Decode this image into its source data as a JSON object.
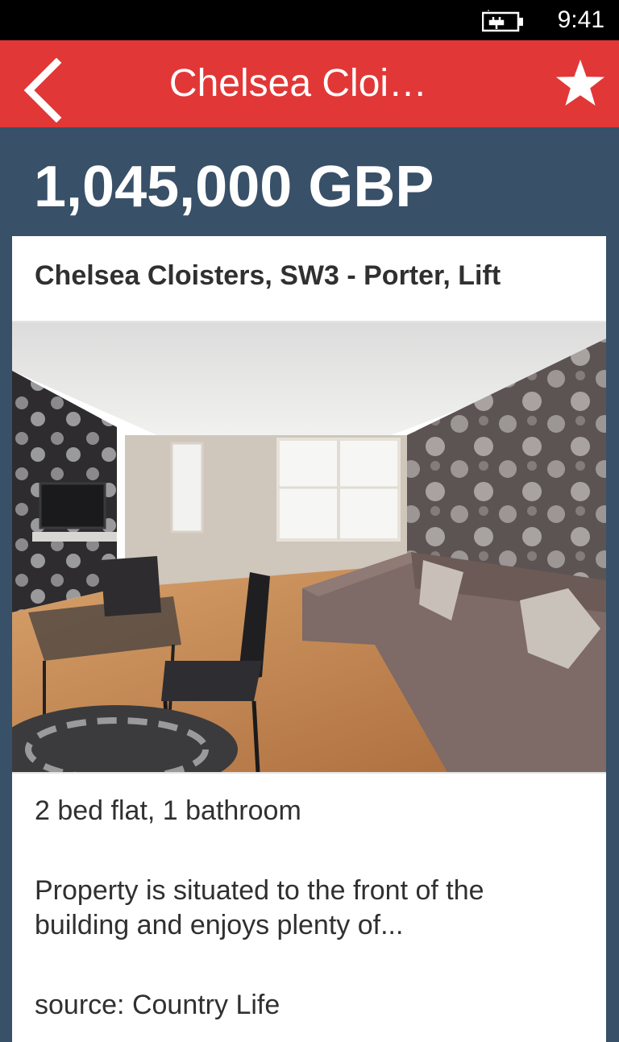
{
  "status_bar": {
    "time": "9:41",
    "battery_icon": "battery-charging-icon"
  },
  "app_bar": {
    "title": "Chelsea Cloi…",
    "back_icon": "chevron-left-icon",
    "favorite_icon": "star-icon",
    "background_color": "#e23737"
  },
  "listing": {
    "price": "1,045,000 GBP",
    "headline": "Chelsea Cloisters, SW3 - Porter, Lift",
    "summary": "2 bed flat, 1 bathroom",
    "description": "Property is situated to the front of the building and enjoys plenty of...",
    "source": "source: Country Life"
  },
  "colors": {
    "page_background": "#385068",
    "accent": "#e23737",
    "card": "#ffffff",
    "text": "#303030"
  }
}
